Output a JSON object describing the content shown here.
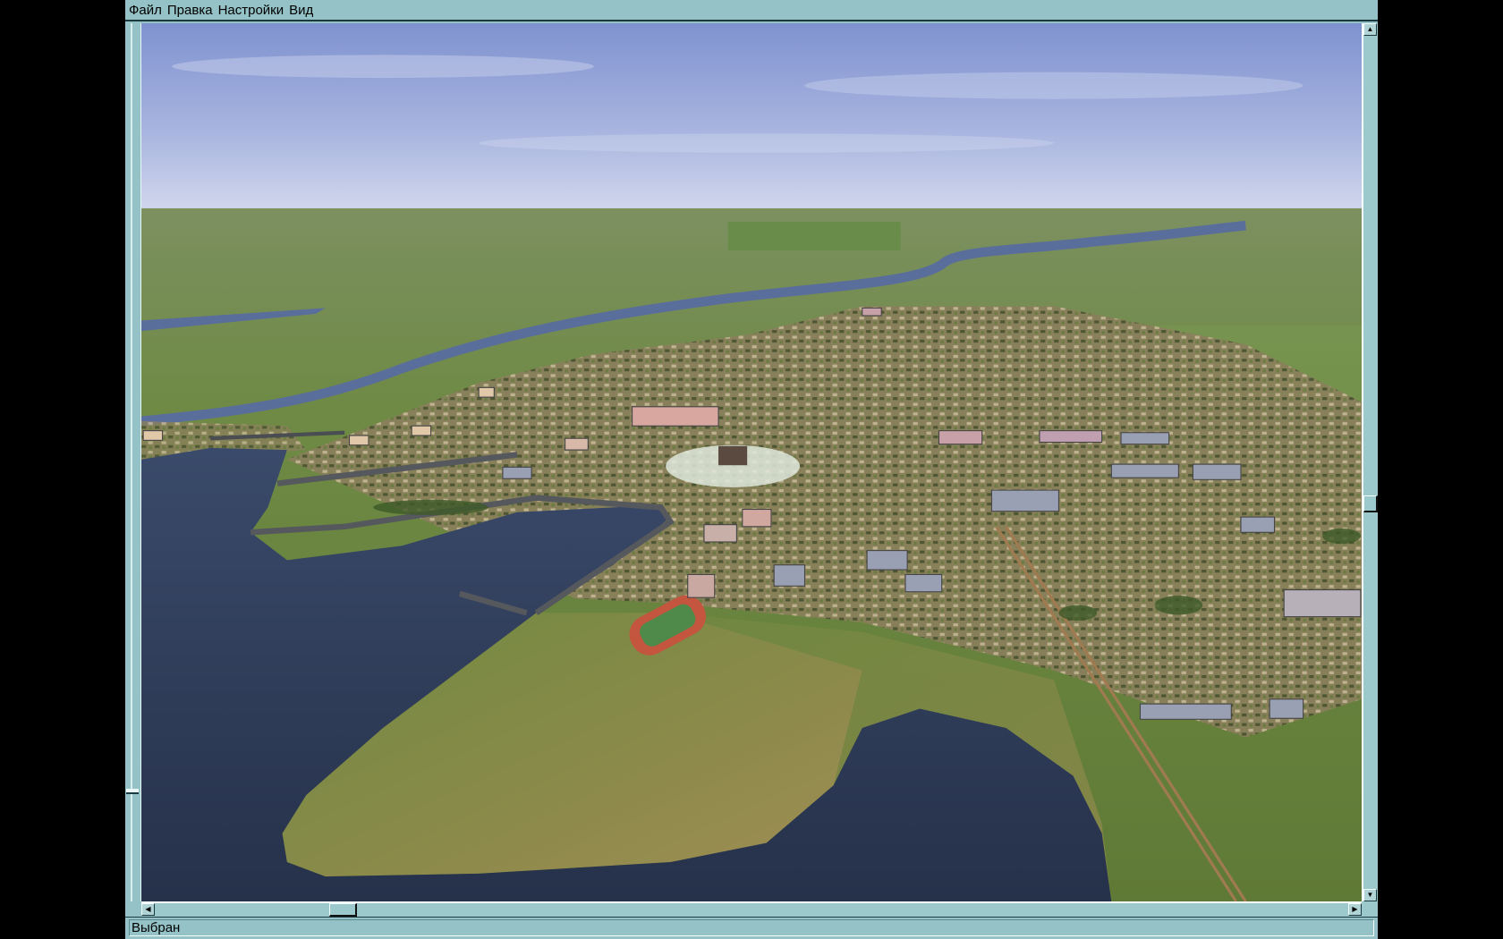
{
  "menu": {
    "items": [
      {
        "label": "Файл"
      },
      {
        "label": "Правка"
      },
      {
        "label": "Настройки"
      },
      {
        "label": "Вид"
      }
    ]
  },
  "scrollbars": {
    "vertical_position_percent": 55,
    "horizontal_position_percent": 15
  },
  "status": {
    "text": "Выбран"
  },
  "colors": {
    "chrome": "#94c2c6",
    "sky_top": "#7f92d0",
    "sky_horizon": "#c9d2ea",
    "land": "#6f8a48",
    "water": "#2f3b58",
    "town": "#8f8460"
  }
}
